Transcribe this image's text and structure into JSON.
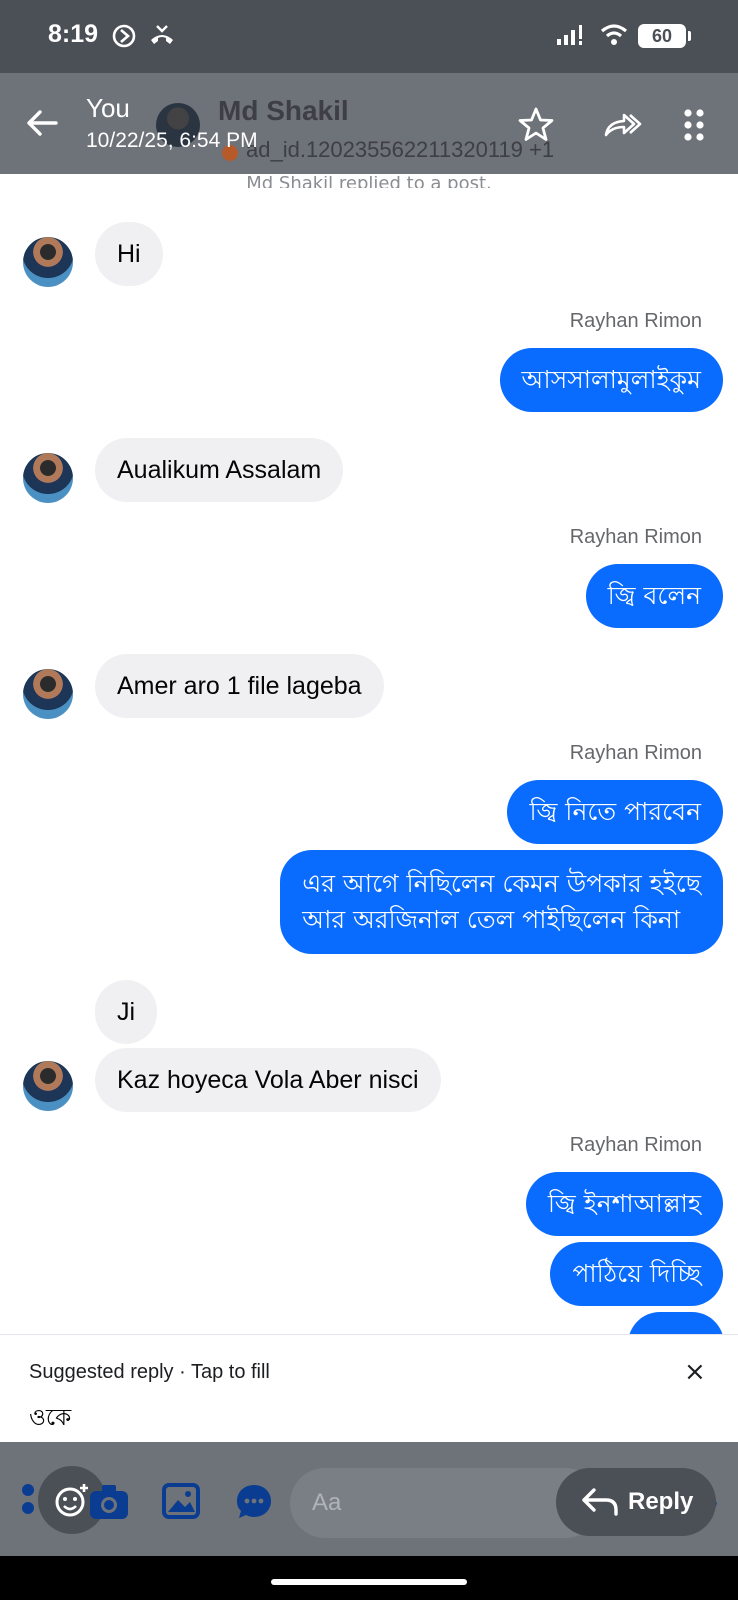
{
  "status_bar": {
    "time": "8:19",
    "battery": "60"
  },
  "header": {
    "you_label": "You",
    "date": "10/22/25, 6:54 PM",
    "contact_name": "Md Shakil",
    "ad_id": "ad_id.120235562211320119 +1"
  },
  "chat": {
    "system_note": "Md Shakil replied to a post.",
    "messages": [
      {
        "dir": "in",
        "text": "Hi"
      },
      {
        "dir": "out",
        "sender": "Rayhan Rimon",
        "text": "আসসালামুলাইকুম"
      },
      {
        "dir": "in",
        "text": "Aualikum Assalam"
      },
      {
        "dir": "out",
        "sender": "Rayhan Rimon",
        "text": "জ্বি বলেন"
      },
      {
        "dir": "in",
        "text": "Amer aro 1 file lageba"
      },
      {
        "dir": "out",
        "sender": "Rayhan Rimon",
        "text": "জ্বি নিতে পারবেন"
      },
      {
        "dir": "out",
        "text_line1": "এর আগে নিছিলেন  কেমন উপকার হইছে",
        "text_line2": "আর অরজিনাল তেল পাইছিলেন কিনা"
      },
      {
        "dir": "in",
        "text": "Ji"
      },
      {
        "dir": "in",
        "text": "Kaz hoyeca Vola Aber nisci"
      },
      {
        "dir": "out",
        "sender": "Rayhan Rimon",
        "text": "জ্বি ইনশাআল্লাহ"
      },
      {
        "dir": "out",
        "text": "পাঠিয়ে দিচ্ছি"
      }
    ]
  },
  "suggested_reply": {
    "label": "Suggested reply · Tap to fill",
    "text": "ওকে",
    "close": "×"
  },
  "composer": {
    "placeholder": "Aa",
    "reply_label": "Reply"
  },
  "colors": {
    "outgoing_bubble": "#0a6cff",
    "incoming_bubble": "#f0f0f2",
    "header_overlay": "#6e7279"
  },
  "icons": [
    "back-arrow-icon",
    "star-icon",
    "forward-icon",
    "more-vertical-icon",
    "apps-icon",
    "camera-icon",
    "image-icon",
    "chat-bubble-icon",
    "like-icon",
    "emoji-icon",
    "reply-arrow-icon"
  ]
}
